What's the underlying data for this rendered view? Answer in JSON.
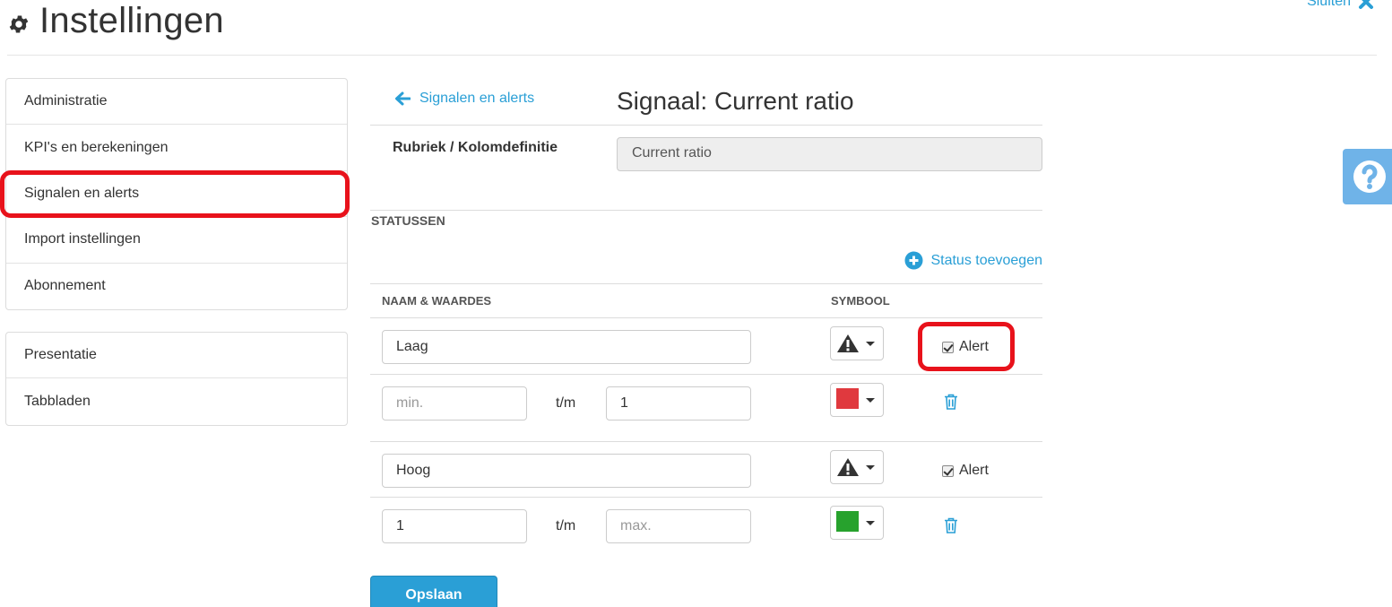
{
  "header": {
    "title": "Instellingen",
    "close_label": "Sluiten"
  },
  "sidebar": {
    "group1": [
      {
        "label": "Administratie"
      },
      {
        "label": "KPI's en berekeningen"
      },
      {
        "label": "Signalen en alerts",
        "active": true
      },
      {
        "label": "Import instellingen"
      },
      {
        "label": "Abonnement"
      }
    ],
    "group2": [
      {
        "label": "Presentatie"
      },
      {
        "label": "Tabbladen"
      }
    ]
  },
  "main": {
    "back_label": "Signalen en alerts",
    "title": "Signaal: Current ratio",
    "rubriek_label": "Rubriek / Kolomdefinitie",
    "rubriek_value": "Current ratio",
    "section_title": "STATUSSEN",
    "add_status_label": "Status toevoegen",
    "columns": {
      "name_values": "NAAM & WAARDES",
      "symbol": "SYMBOOL"
    },
    "statuses": [
      {
        "name": "Laag",
        "min_value": "",
        "min_placeholder": "min.",
        "range_sep": "t/m",
        "max_value": "1",
        "max_placeholder": "max.",
        "symbol_icon": "warning-icon",
        "color": "#e0393e",
        "alert_label": "Alert",
        "alert_checked": true
      },
      {
        "name": "Hoog",
        "min_value": "1",
        "min_placeholder": "min.",
        "range_sep": "t/m",
        "max_value": "",
        "max_placeholder": "max.",
        "symbol_icon": "warning-icon",
        "color": "#27a22d",
        "alert_label": "Alert",
        "alert_checked": true
      }
    ],
    "save_label": "Opslaan"
  },
  "colors": {
    "accent": "#2a9fd6",
    "highlight": "#e8121b",
    "help_tab": "#6fb3e8"
  }
}
